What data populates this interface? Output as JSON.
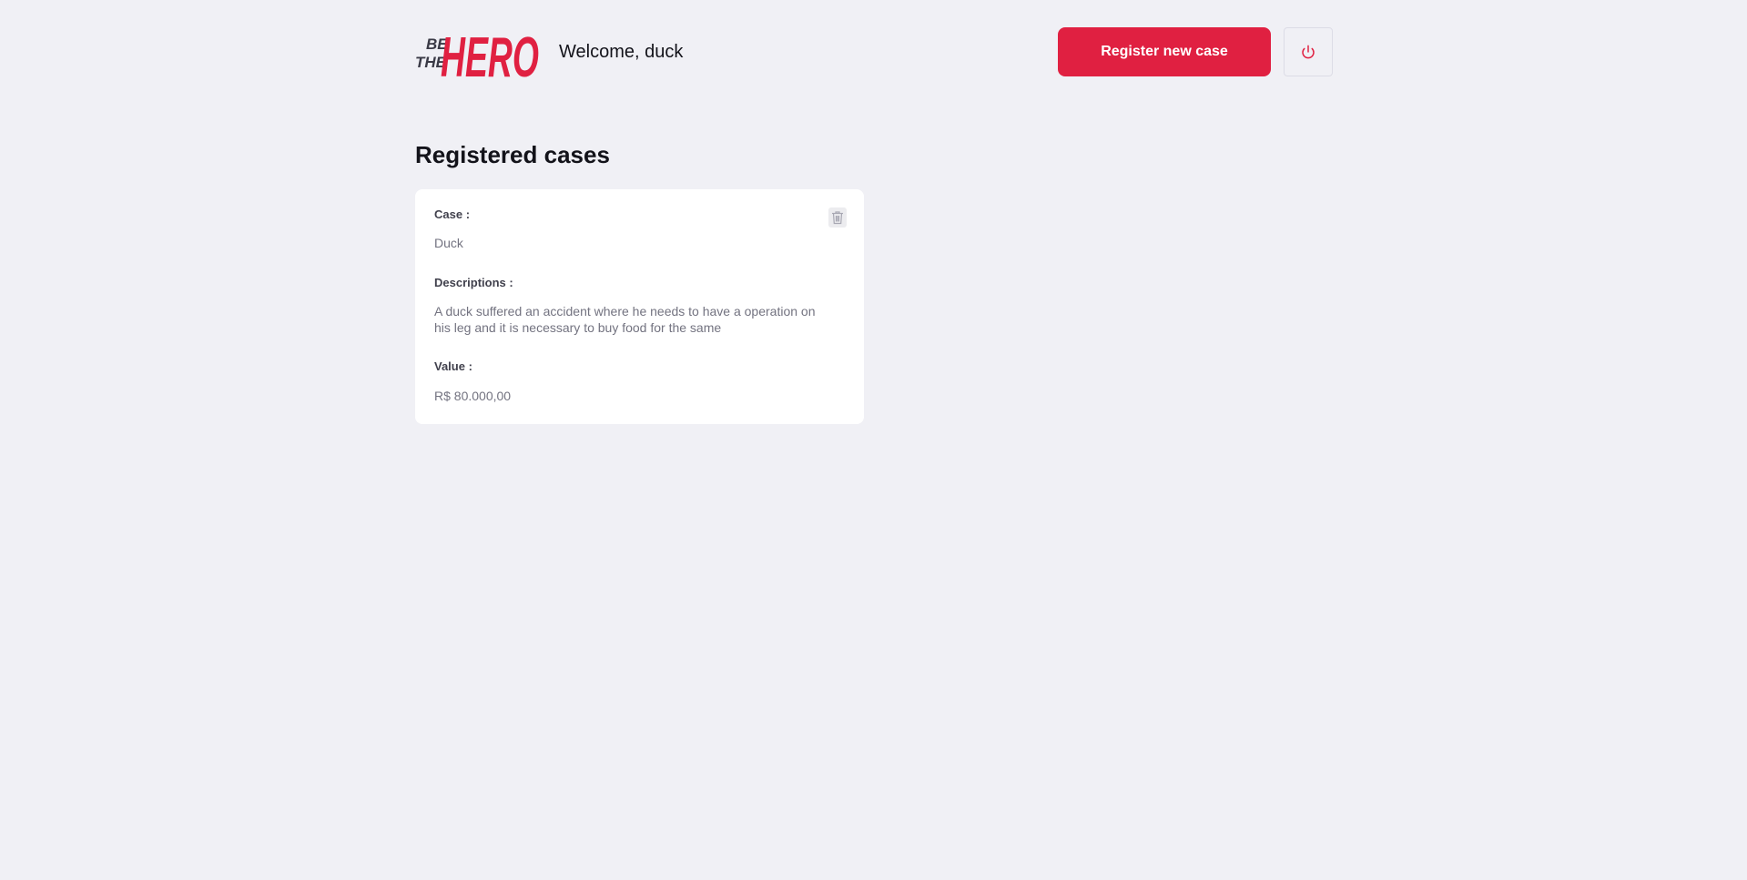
{
  "header": {
    "logo_alt": "Be The Hero",
    "welcome_text": "Welcome, duck",
    "register_button_label": "Register new case",
    "logout_icon": "power-icon"
  },
  "main": {
    "title": "Registered cases",
    "cases": [
      {
        "case_label": "Case :",
        "case_value": "Duck",
        "description_label": "Descriptions :",
        "description_value": "A duck suffered an accident where he needs to have a operation on his leg and it is necessary to buy food for the same",
        "value_label": "Value :",
        "value_value": "R$ 80.000,00",
        "delete_icon": "trash-icon"
      }
    ]
  },
  "colors": {
    "background": "#f0f0f5",
    "accent": "#e02041",
    "card": "#ffffff",
    "label": "#41414d",
    "muted_text": "#737380"
  }
}
